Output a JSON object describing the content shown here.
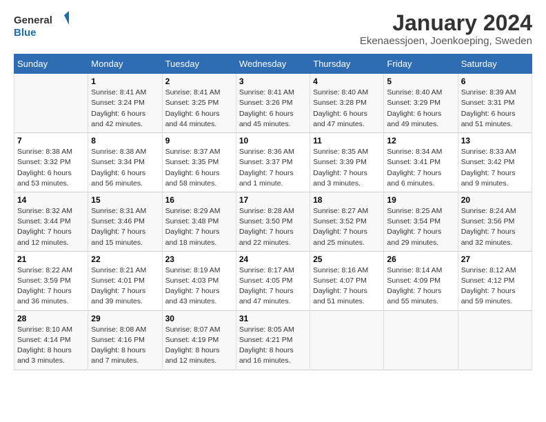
{
  "logo": {
    "line1": "General",
    "line2": "Blue"
  },
  "title": "January 2024",
  "subtitle": "Ekenaessjoen, Joenkoeping, Sweden",
  "days_header": [
    "Sunday",
    "Monday",
    "Tuesday",
    "Wednesday",
    "Thursday",
    "Friday",
    "Saturday"
  ],
  "weeks": [
    [
      {
        "day": "",
        "text": ""
      },
      {
        "day": "1",
        "text": "Sunrise: 8:41 AM\nSunset: 3:24 PM\nDaylight: 6 hours\nand 42 minutes."
      },
      {
        "day": "2",
        "text": "Sunrise: 8:41 AM\nSunset: 3:25 PM\nDaylight: 6 hours\nand 44 minutes."
      },
      {
        "day": "3",
        "text": "Sunrise: 8:41 AM\nSunset: 3:26 PM\nDaylight: 6 hours\nand 45 minutes."
      },
      {
        "day": "4",
        "text": "Sunrise: 8:40 AM\nSunset: 3:28 PM\nDaylight: 6 hours\nand 47 minutes."
      },
      {
        "day": "5",
        "text": "Sunrise: 8:40 AM\nSunset: 3:29 PM\nDaylight: 6 hours\nand 49 minutes."
      },
      {
        "day": "6",
        "text": "Sunrise: 8:39 AM\nSunset: 3:31 PM\nDaylight: 6 hours\nand 51 minutes."
      }
    ],
    [
      {
        "day": "7",
        "text": "Sunrise: 8:38 AM\nSunset: 3:32 PM\nDaylight: 6 hours\nand 53 minutes."
      },
      {
        "day": "8",
        "text": "Sunrise: 8:38 AM\nSunset: 3:34 PM\nDaylight: 6 hours\nand 56 minutes."
      },
      {
        "day": "9",
        "text": "Sunrise: 8:37 AM\nSunset: 3:35 PM\nDaylight: 6 hours\nand 58 minutes."
      },
      {
        "day": "10",
        "text": "Sunrise: 8:36 AM\nSunset: 3:37 PM\nDaylight: 7 hours\nand 1 minute."
      },
      {
        "day": "11",
        "text": "Sunrise: 8:35 AM\nSunset: 3:39 PM\nDaylight: 7 hours\nand 3 minutes."
      },
      {
        "day": "12",
        "text": "Sunrise: 8:34 AM\nSunset: 3:41 PM\nDaylight: 7 hours\nand 6 minutes."
      },
      {
        "day": "13",
        "text": "Sunrise: 8:33 AM\nSunset: 3:42 PM\nDaylight: 7 hours\nand 9 minutes."
      }
    ],
    [
      {
        "day": "14",
        "text": "Sunrise: 8:32 AM\nSunset: 3:44 PM\nDaylight: 7 hours\nand 12 minutes."
      },
      {
        "day": "15",
        "text": "Sunrise: 8:31 AM\nSunset: 3:46 PM\nDaylight: 7 hours\nand 15 minutes."
      },
      {
        "day": "16",
        "text": "Sunrise: 8:29 AM\nSunset: 3:48 PM\nDaylight: 7 hours\nand 18 minutes."
      },
      {
        "day": "17",
        "text": "Sunrise: 8:28 AM\nSunset: 3:50 PM\nDaylight: 7 hours\nand 22 minutes."
      },
      {
        "day": "18",
        "text": "Sunrise: 8:27 AM\nSunset: 3:52 PM\nDaylight: 7 hours\nand 25 minutes."
      },
      {
        "day": "19",
        "text": "Sunrise: 8:25 AM\nSunset: 3:54 PM\nDaylight: 7 hours\nand 29 minutes."
      },
      {
        "day": "20",
        "text": "Sunrise: 8:24 AM\nSunset: 3:56 PM\nDaylight: 7 hours\nand 32 minutes."
      }
    ],
    [
      {
        "day": "21",
        "text": "Sunrise: 8:22 AM\nSunset: 3:59 PM\nDaylight: 7 hours\nand 36 minutes."
      },
      {
        "day": "22",
        "text": "Sunrise: 8:21 AM\nSunset: 4:01 PM\nDaylight: 7 hours\nand 39 minutes."
      },
      {
        "day": "23",
        "text": "Sunrise: 8:19 AM\nSunset: 4:03 PM\nDaylight: 7 hours\nand 43 minutes."
      },
      {
        "day": "24",
        "text": "Sunrise: 8:17 AM\nSunset: 4:05 PM\nDaylight: 7 hours\nand 47 minutes."
      },
      {
        "day": "25",
        "text": "Sunrise: 8:16 AM\nSunset: 4:07 PM\nDaylight: 7 hours\nand 51 minutes."
      },
      {
        "day": "26",
        "text": "Sunrise: 8:14 AM\nSunset: 4:09 PM\nDaylight: 7 hours\nand 55 minutes."
      },
      {
        "day": "27",
        "text": "Sunrise: 8:12 AM\nSunset: 4:12 PM\nDaylight: 7 hours\nand 59 minutes."
      }
    ],
    [
      {
        "day": "28",
        "text": "Sunrise: 8:10 AM\nSunset: 4:14 PM\nDaylight: 8 hours\nand 3 minutes."
      },
      {
        "day": "29",
        "text": "Sunrise: 8:08 AM\nSunset: 4:16 PM\nDaylight: 8 hours\nand 7 minutes."
      },
      {
        "day": "30",
        "text": "Sunrise: 8:07 AM\nSunset: 4:19 PM\nDaylight: 8 hours\nand 12 minutes."
      },
      {
        "day": "31",
        "text": "Sunrise: 8:05 AM\nSunset: 4:21 PM\nDaylight: 8 hours\nand 16 minutes."
      },
      {
        "day": "",
        "text": ""
      },
      {
        "day": "",
        "text": ""
      },
      {
        "day": "",
        "text": ""
      }
    ]
  ]
}
